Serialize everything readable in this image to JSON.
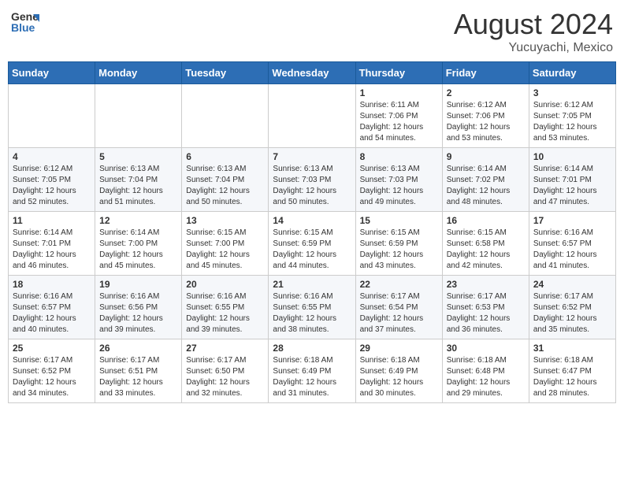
{
  "header": {
    "logo_general": "General",
    "logo_blue": "Blue",
    "month_year": "August 2024",
    "location": "Yucuyachi, Mexico"
  },
  "days_of_week": [
    "Sunday",
    "Monday",
    "Tuesday",
    "Wednesday",
    "Thursday",
    "Friday",
    "Saturday"
  ],
  "weeks": [
    [
      {
        "day": "",
        "info": ""
      },
      {
        "day": "",
        "info": ""
      },
      {
        "day": "",
        "info": ""
      },
      {
        "day": "",
        "info": ""
      },
      {
        "day": "1",
        "info": "Sunrise: 6:11 AM\nSunset: 7:06 PM\nDaylight: 12 hours\nand 54 minutes."
      },
      {
        "day": "2",
        "info": "Sunrise: 6:12 AM\nSunset: 7:06 PM\nDaylight: 12 hours\nand 53 minutes."
      },
      {
        "day": "3",
        "info": "Sunrise: 6:12 AM\nSunset: 7:05 PM\nDaylight: 12 hours\nand 53 minutes."
      }
    ],
    [
      {
        "day": "4",
        "info": "Sunrise: 6:12 AM\nSunset: 7:05 PM\nDaylight: 12 hours\nand 52 minutes."
      },
      {
        "day": "5",
        "info": "Sunrise: 6:13 AM\nSunset: 7:04 PM\nDaylight: 12 hours\nand 51 minutes."
      },
      {
        "day": "6",
        "info": "Sunrise: 6:13 AM\nSunset: 7:04 PM\nDaylight: 12 hours\nand 50 minutes."
      },
      {
        "day": "7",
        "info": "Sunrise: 6:13 AM\nSunset: 7:03 PM\nDaylight: 12 hours\nand 50 minutes."
      },
      {
        "day": "8",
        "info": "Sunrise: 6:13 AM\nSunset: 7:03 PM\nDaylight: 12 hours\nand 49 minutes."
      },
      {
        "day": "9",
        "info": "Sunrise: 6:14 AM\nSunset: 7:02 PM\nDaylight: 12 hours\nand 48 minutes."
      },
      {
        "day": "10",
        "info": "Sunrise: 6:14 AM\nSunset: 7:01 PM\nDaylight: 12 hours\nand 47 minutes."
      }
    ],
    [
      {
        "day": "11",
        "info": "Sunrise: 6:14 AM\nSunset: 7:01 PM\nDaylight: 12 hours\nand 46 minutes."
      },
      {
        "day": "12",
        "info": "Sunrise: 6:14 AM\nSunset: 7:00 PM\nDaylight: 12 hours\nand 45 minutes."
      },
      {
        "day": "13",
        "info": "Sunrise: 6:15 AM\nSunset: 7:00 PM\nDaylight: 12 hours\nand 45 minutes."
      },
      {
        "day": "14",
        "info": "Sunrise: 6:15 AM\nSunset: 6:59 PM\nDaylight: 12 hours\nand 44 minutes."
      },
      {
        "day": "15",
        "info": "Sunrise: 6:15 AM\nSunset: 6:59 PM\nDaylight: 12 hours\nand 43 minutes."
      },
      {
        "day": "16",
        "info": "Sunrise: 6:15 AM\nSunset: 6:58 PM\nDaylight: 12 hours\nand 42 minutes."
      },
      {
        "day": "17",
        "info": "Sunrise: 6:16 AM\nSunset: 6:57 PM\nDaylight: 12 hours\nand 41 minutes."
      }
    ],
    [
      {
        "day": "18",
        "info": "Sunrise: 6:16 AM\nSunset: 6:57 PM\nDaylight: 12 hours\nand 40 minutes."
      },
      {
        "day": "19",
        "info": "Sunrise: 6:16 AM\nSunset: 6:56 PM\nDaylight: 12 hours\nand 39 minutes."
      },
      {
        "day": "20",
        "info": "Sunrise: 6:16 AM\nSunset: 6:55 PM\nDaylight: 12 hours\nand 39 minutes."
      },
      {
        "day": "21",
        "info": "Sunrise: 6:16 AM\nSunset: 6:55 PM\nDaylight: 12 hours\nand 38 minutes."
      },
      {
        "day": "22",
        "info": "Sunrise: 6:17 AM\nSunset: 6:54 PM\nDaylight: 12 hours\nand 37 minutes."
      },
      {
        "day": "23",
        "info": "Sunrise: 6:17 AM\nSunset: 6:53 PM\nDaylight: 12 hours\nand 36 minutes."
      },
      {
        "day": "24",
        "info": "Sunrise: 6:17 AM\nSunset: 6:52 PM\nDaylight: 12 hours\nand 35 minutes."
      }
    ],
    [
      {
        "day": "25",
        "info": "Sunrise: 6:17 AM\nSunset: 6:52 PM\nDaylight: 12 hours\nand 34 minutes."
      },
      {
        "day": "26",
        "info": "Sunrise: 6:17 AM\nSunset: 6:51 PM\nDaylight: 12 hours\nand 33 minutes."
      },
      {
        "day": "27",
        "info": "Sunrise: 6:17 AM\nSunset: 6:50 PM\nDaylight: 12 hours\nand 32 minutes."
      },
      {
        "day": "28",
        "info": "Sunrise: 6:18 AM\nSunset: 6:49 PM\nDaylight: 12 hours\nand 31 minutes."
      },
      {
        "day": "29",
        "info": "Sunrise: 6:18 AM\nSunset: 6:49 PM\nDaylight: 12 hours\nand 30 minutes."
      },
      {
        "day": "30",
        "info": "Sunrise: 6:18 AM\nSunset: 6:48 PM\nDaylight: 12 hours\nand 29 minutes."
      },
      {
        "day": "31",
        "info": "Sunrise: 6:18 AM\nSunset: 6:47 PM\nDaylight: 12 hours\nand 28 minutes."
      }
    ]
  ]
}
